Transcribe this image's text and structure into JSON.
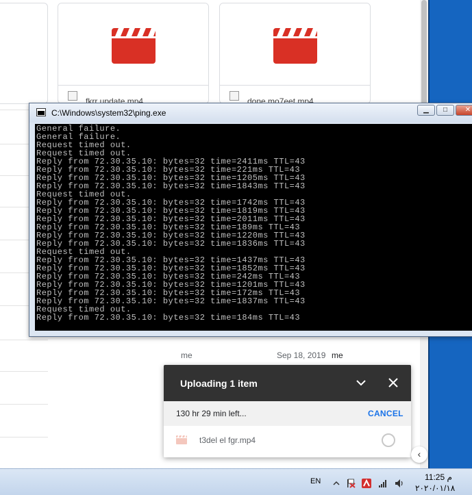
{
  "drive": {
    "files": [
      {
        "name": "fkrr update.mp4"
      },
      {
        "name": "done mo7eet.mp4"
      }
    ],
    "rows": [
      {
        "owner": "me",
        "date": "Sep 18, 2019",
        "modified_by": "me"
      }
    ]
  },
  "console": {
    "title": "C:\\Windows\\system32\\ping.exe",
    "buttons": {
      "minimize": "▁",
      "maximize": "□",
      "close": "✕"
    },
    "lines": [
      "General failure.",
      "General failure.",
      "Request timed out.",
      "Request timed out.",
      "Reply from 72.30.35.10: bytes=32 time=2411ms TTL=43",
      "Reply from 72.30.35.10: bytes=32 time=221ms TTL=43",
      "Reply from 72.30.35.10: bytes=32 time=1205ms TTL=43",
      "Reply from 72.30.35.10: bytes=32 time=1843ms TTL=43",
      "Request timed out.",
      "Reply from 72.30.35.10: bytes=32 time=1742ms TTL=43",
      "Reply from 72.30.35.10: bytes=32 time=1819ms TTL=43",
      "Reply from 72.30.35.10: bytes=32 time=2011ms TTL=43",
      "Reply from 72.30.35.10: bytes=32 time=189ms TTL=43",
      "Reply from 72.30.35.10: bytes=32 time=1220ms TTL=43",
      "Reply from 72.30.35.10: bytes=32 time=1836ms TTL=43",
      "Request timed out.",
      "Reply from 72.30.35.10: bytes=32 time=1437ms TTL=43",
      "Reply from 72.30.35.10: bytes=32 time=1852ms TTL=43",
      "Reply from 72.30.35.10: bytes=32 time=242ms TTL=43",
      "Reply from 72.30.35.10: bytes=32 time=1201ms TTL=43",
      "Reply from 72.30.35.10: bytes=32 time=172ms TTL=43",
      "Reply from 72.30.35.10: bytes=32 time=1837ms TTL=43",
      "Request timed out.",
      "Reply from 72.30.35.10: bytes=32 time=184ms TTL=43"
    ]
  },
  "upload": {
    "title": "Uploading 1 item",
    "eta": "130 hr 29 min left...",
    "cancel_label": "CANCEL",
    "file_name": "t3del el fgr.mp4",
    "progress": 0
  },
  "taskbar": {
    "language": "EN",
    "time": "11:25 م",
    "date": "٢٠٢٠/٠١/١٨"
  },
  "colors": {
    "video_icon": "#d93025",
    "console_bg": "#000000",
    "console_text": "#c0c0c0",
    "toast_header": "#323232",
    "cancel_link": "#1a73e8",
    "desktop": "#1565c0"
  },
  "icons": [
    "video-clapper-icon",
    "broken-image-icon",
    "chevron-down-icon",
    "close-icon",
    "video-file-icon",
    "cmd-icon",
    "chevron-left-icon",
    "network-icon",
    "flag-icon",
    "antivirus-icon",
    "volume-icon"
  ]
}
